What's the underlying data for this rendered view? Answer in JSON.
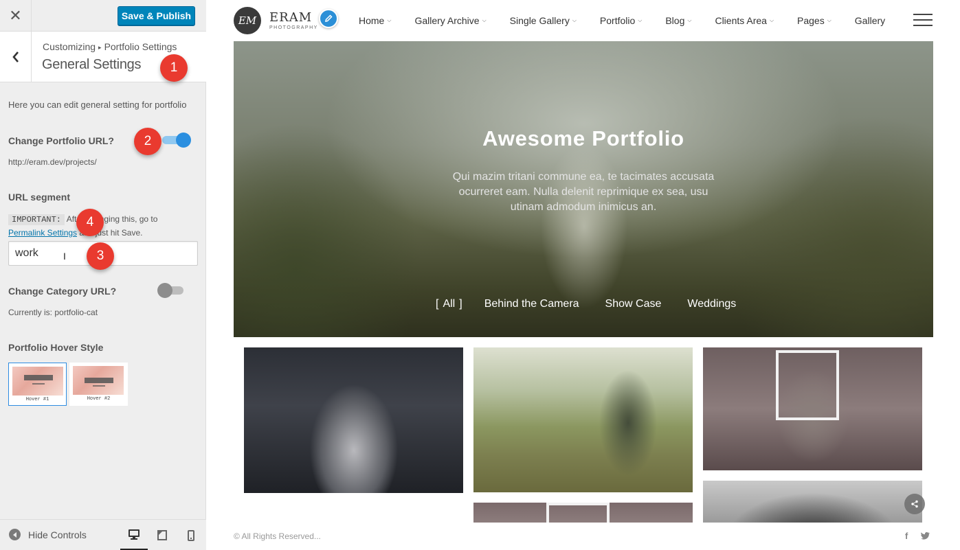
{
  "customizer": {
    "close_icon": "close-icon",
    "publish_label": "Save & Publish",
    "breadcrumb": {
      "root": "Customizing",
      "parent": "Portfolio Settings"
    },
    "section_title": "General Settings",
    "description": "Here you can edit general setting for portfolio",
    "portfolio_url": {
      "label": "Change Portfolio URL?",
      "enabled": true,
      "current": "http://eram.dev/projects/"
    },
    "url_segment": {
      "label": "URL segment",
      "important_tag": "IMPORTANT:",
      "note_before": "After changing this, go to",
      "link_text": "Permalink Settings",
      "note_after": "and just hit Save.",
      "value": "work"
    },
    "category_url": {
      "label": "Change Category URL?",
      "enabled": false,
      "current": "Currently is: portfolio-cat"
    },
    "hover_style": {
      "label": "Portfolio Hover Style",
      "options": [
        "Hover #1",
        "Hover #2"
      ],
      "selected": "Hover #1"
    },
    "footer": {
      "hide_controls": "Hide Controls",
      "active_device": "desktop"
    }
  },
  "badges": [
    "1",
    "2",
    "3",
    "4"
  ],
  "site": {
    "logo": {
      "initials": "EM",
      "name": "ERAM",
      "sub": "PHOTOGRAPHY"
    },
    "nav": [
      {
        "label": "Home",
        "dropdown": true
      },
      {
        "label": "Gallery Archive",
        "dropdown": true
      },
      {
        "label": "Single Gallery",
        "dropdown": true
      },
      {
        "label": "Portfolio",
        "dropdown": true
      },
      {
        "label": "Blog",
        "dropdown": true
      },
      {
        "label": "Clients Area",
        "dropdown": true
      },
      {
        "label": "Pages",
        "dropdown": true
      },
      {
        "label": "Gallery",
        "dropdown": false
      }
    ],
    "hero": {
      "title": "Awesome Portfolio",
      "description": "Qui mazim tritani commune ea, te tacimates accusata ocurreret eam. Nulla delenit reprimique ex sea, usu utinam admodum inimicus an.",
      "filters": [
        "All",
        "Behind the Camera",
        "Show Case",
        "Weddings"
      ],
      "active_filter": "All"
    },
    "footer": {
      "copyright": "© All Rights Reserved...",
      "social": [
        "facebook-icon",
        "twitter-icon"
      ]
    }
  },
  "colors": {
    "accent": "#0085ba",
    "toggle_on": "#2b8fe0",
    "badge": "#e93a2f"
  }
}
